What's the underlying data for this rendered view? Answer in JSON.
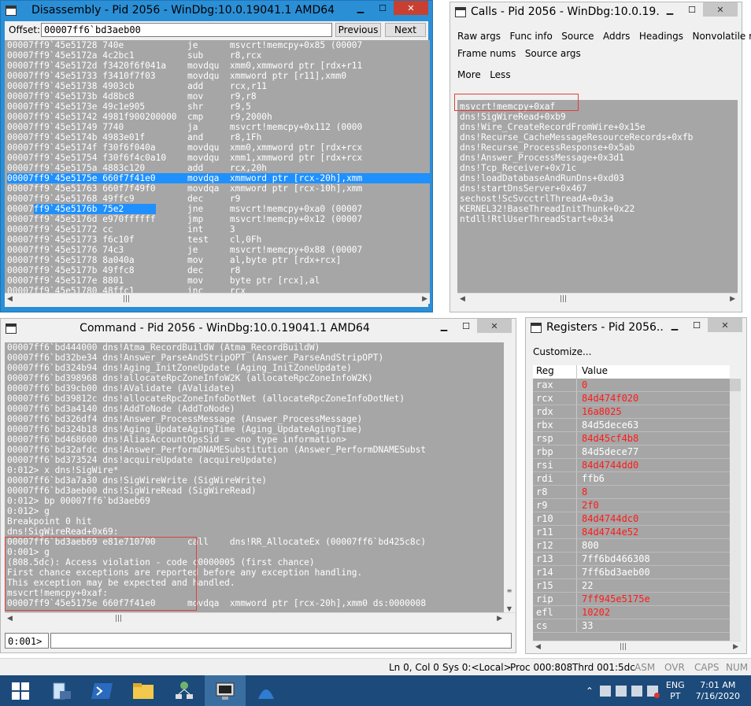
{
  "disasm": {
    "title": "Disassembly - Pid 2056 - WinDbg:10.0.19041.1 AMD64",
    "offset_label": "Offset:",
    "offset_value": "00007ff6`bd3aeb00",
    "prev_label": "Previous",
    "next_label": "Next",
    "lines": [
      "00007ff9`45e51728 740e            je      msvcrt!memcpy+0x85 (00007",
      "00007ff9`45e5172a 4c2bc1          sub     r8,rcx",
      "00007ff9`45e5172d f3420f6f041a    movdqu  xmm0,xmmword ptr [rdx+r11",
      "00007ff9`45e51733 f3410f7f03      movdqu  xmmword ptr [r11],xmm0",
      "00007ff9`45e51738 4903cb          add     rcx,r11",
      "00007ff9`45e5173b 4d8bc8          mov     r9,r8",
      "00007ff9`45e5173e 49c1e905        shr     r9,5",
      "00007ff9`45e51742 4981f900200000  cmp     r9,2000h",
      "00007ff9`45e51749 7740            ja      msvcrt!memcpy+0x112 (0000",
      "00007ff9`45e5174b 4983e01f        and     r8,1Fh",
      "00007ff9`45e5174f f30f6f040a      movdqu  xmm0,xmmword ptr [rdx+rcx",
      "00007ff9`45e51754 f30f6f4c0a10    movdqu  xmm1,xmmword ptr [rdx+rcx",
      "00007ff9`45e5175a 4883c120        add     rcx,20h",
      "00007ff9`45e5175e 660f7f41e0      movdqa  xmmword ptr [rcx-20h],xmm",
      "00007ff9`45e51763 660f7f49f0      movdqa  xmmword ptr [rcx-10h],xmm",
      "00007ff9`45e51768 49ffc9          dec     r9",
      "00007ff9`45e5176b 75e2            jne     msvcrt!memcpy+0xa0 (00007",
      "00007ff9`45e5176d e970ffffff      jmp     msvcrt!memcpy+0x12 (00007",
      "00007ff9`45e51772 cc              int     3",
      "00007ff9`45e51773 f6c10f          test    cl,0Fh",
      "00007ff9`45e51776 74c3            je      msvcrt!memcpy+0x88 (00007",
      "00007ff9`45e51778 8a040a          mov     al,byte ptr [rdx+rcx]",
      "00007ff9`45e5177b 49ffc8          dec     r8",
      "00007ff9`45e5177e 8801            mov     byte ptr [rcx],al",
      "00007ff9`45e51780 48ffc1          inc     rcx"
    ],
    "selected_index": 13,
    "highlight_index": 16
  },
  "calls": {
    "title": "Calls - Pid 2056 - WinDbg:10.0.19...",
    "options_row1": [
      "Raw args",
      "Func info",
      "Source",
      "Addrs",
      "Headings",
      "Nonvolatile regs"
    ],
    "options_row2": [
      "Frame nums",
      "Source args"
    ],
    "options_row3": [
      "More",
      "Less"
    ],
    "frames": [
      "msvcrt!memcpy+0xaf",
      "dns!SigWireRead+0xb9",
      "dns!Wire_CreateRecordFromWire+0x15e",
      "dns!Recurse_CacheMessageResourceRecords+0xfb",
      "dns!Recurse_ProcessResponse+0x5ab",
      "dns!Answer_ProcessMessage+0x3d1",
      "dns!Tcp_Receiver+0x71c",
      "dns!loadDatabaseAndRunDns+0xd03",
      "dns!startDnsServer+0x467",
      "sechost!ScSvcctrlThreadA+0x3a",
      "KERNEL32!BaseThreadInitThunk+0x22",
      "ntdll!RtlUserThreadStart+0x34"
    ]
  },
  "command": {
    "title": "Command - Pid 2056 - WinDbg:10.0.19041.1 AMD64",
    "lines": [
      "00007ff6`bd444000 dns!Atma_RecordBuildW (Atma_RecordBuildW)",
      "00007ff6`bd32be34 dns!Answer_ParseAndStripOPT (Answer_ParseAndStripOPT)",
      "00007ff6`bd324b94 dns!Aging_InitZoneUpdate (Aging_InitZoneUpdate)",
      "00007ff6`bd398968 dns!allocateRpcZoneInfoW2K (allocateRpcZoneInfoW2K)",
      "00007ff6`bd39cb00 dns!AValidate (AValidate)",
      "00007ff6`bd39812c dns!allocateRpcZoneInfoDotNet (allocateRpcZoneInfoDotNet)",
      "00007ff6`bd3a4140 dns!AddToNode (AddToNode)",
      "00007ff6`bd326df4 dns!Answer_ProcessMessage (Answer_ProcessMessage)",
      "00007ff6`bd324b18 dns!Aging_UpdateAgingTime (Aging_UpdateAgingTime)",
      "00007ff6`bd468600 dns!AliasAccountOpsSid = <no type information>",
      "00007ff6`bd32afdc dns!Answer_PerformDNAMESubstitution (Answer_PerformDNAMESubst",
      "00007ff6`bd373524 dns!acquireUpdate (acquireUpdate)",
      "0:012> x dns!SigWire*",
      "00007ff6`bd3a7a30 dns!SigWireWrite (SigWireWrite)",
      "00007ff6`bd3aeb00 dns!SigWireRead (SigWireRead)",
      "0:012> bp 00007ff6`bd3aeb69",
      "0:012> g",
      "Breakpoint 0 hit",
      "dns!SigWireRead+0x69:",
      "00007ff6`bd3aeb69 e81e710700      call    dns!RR_AllocateEx (00007ff6`bd425c8c)",
      "0:001> g",
      "(808.5dc): Access violation - code c0000005 (first chance)",
      "First chance exceptions are reported before any exception handling.",
      "This exception may be expected and handled.",
      "msvcrt!memcpy+0xaf:",
      "00007ff9`45e5175e 660f7f41e0      movdqa  xmmword ptr [rcx-20h],xmm0 ds:0000008"
    ],
    "prompt": "0:001>",
    "input_value": ""
  },
  "registers": {
    "title": "Registers - Pid 2056...",
    "customize_label": "Customize...",
    "col_reg": "Reg",
    "col_value": "Value",
    "rows": [
      {
        "reg": "rax",
        "value": "0",
        "changed": true
      },
      {
        "reg": "rcx",
        "value": "84d474f020",
        "changed": true
      },
      {
        "reg": "rdx",
        "value": "16a8025",
        "changed": true
      },
      {
        "reg": "rbx",
        "value": "84d5dece63",
        "changed": false
      },
      {
        "reg": "rsp",
        "value": "84d45cf4b8",
        "changed": true
      },
      {
        "reg": "rbp",
        "value": "84d5dece77",
        "changed": false
      },
      {
        "reg": "rsi",
        "value": "84d4744dd0",
        "changed": true
      },
      {
        "reg": "rdi",
        "value": "ffb6",
        "changed": false
      },
      {
        "reg": "r8",
        "value": "8",
        "changed": true
      },
      {
        "reg": "r9",
        "value": "2f0",
        "changed": true
      },
      {
        "reg": "r10",
        "value": "84d4744dc0",
        "changed": true
      },
      {
        "reg": "r11",
        "value": "84d4744e52",
        "changed": true
      },
      {
        "reg": "r12",
        "value": "800",
        "changed": false
      },
      {
        "reg": "r13",
        "value": "7ff6bd466308",
        "changed": false
      },
      {
        "reg": "r14",
        "value": "7ff6bd3aeb00",
        "changed": false
      },
      {
        "reg": "r15",
        "value": "22",
        "changed": false
      },
      {
        "reg": "rip",
        "value": "7ff945e5175e",
        "changed": true
      },
      {
        "reg": "efl",
        "value": "10202",
        "changed": true
      },
      {
        "reg": "cs",
        "value": "33",
        "changed": false
      }
    ]
  },
  "statusbar": {
    "ln_col": "Ln 0, Col 0",
    "sys": "Sys 0:<Local>",
    "proc": "Proc 000:808",
    "thrd": "Thrd 001:5dc",
    "asm": "ASM",
    "ovr": "OVR",
    "caps": "CAPS",
    "num": "NUM"
  },
  "taskbar": {
    "lang_top": "ENG",
    "lang_bottom": "PT",
    "time": "7:01 AM",
    "date": "7/16/2020"
  },
  "colors": {
    "active_title": "#2b8fd6",
    "pane_grey": "#a6a6a6",
    "selection_blue": "#1e90ff",
    "register_changed": "#ff1a1a",
    "callout_red": "#e0403a",
    "taskbar": "#1c4a7a"
  }
}
